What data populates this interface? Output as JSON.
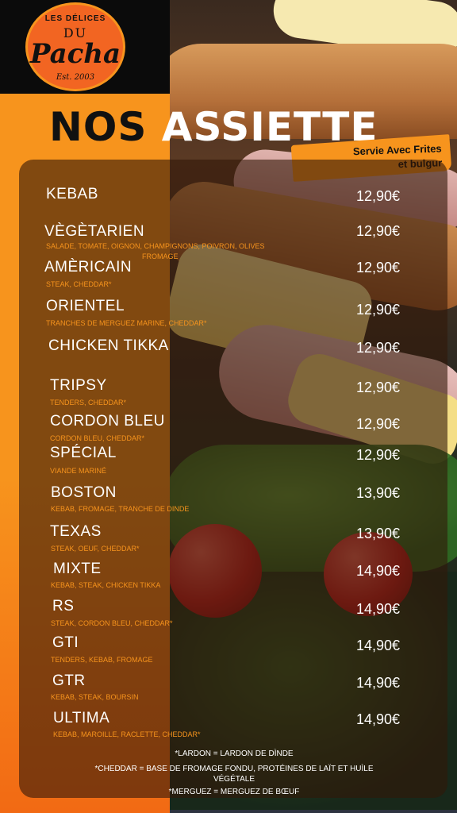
{
  "logo": {
    "top": "LES DÉLICES",
    "du": "DU",
    "main": "Pacha",
    "est": "Est. 2003"
  },
  "title": {
    "part1": "NOS",
    "part2": "ASSIETTE"
  },
  "badge": {
    "line1": "Servie Avec Frites",
    "line2": "et bulgur"
  },
  "colors": {
    "orange": "#f7941d",
    "dark_orange": "#f26522",
    "black": "#0b0b0b"
  },
  "menu": [
    {
      "name": "KEBAB",
      "price": "12,90€",
      "desc": ""
    },
    {
      "name": "VÈGÈTARIEN",
      "price": "12,90€",
      "desc": "SALADE, TOMATE, OIGNON, CHAMPIGNONS, POIVRON, OLIVES",
      "desc2": "FROMAGE"
    },
    {
      "name": "AMÈRICAIN",
      "price": "12,90€",
      "desc": "STEAK, CHEDDAR*"
    },
    {
      "name": "ORIENTEL",
      "price": "12,90€",
      "desc": "TRANCHES DE MERGUEZ MARINE, CHEDDAR*"
    },
    {
      "name": "CHICKEN TIKKA",
      "price": "12,90€",
      "desc": ""
    },
    {
      "name": "TRIPSY",
      "price": "12,90€",
      "desc": "TENDERS, CHEDDAR*"
    },
    {
      "name": "CORDON BLEU",
      "price": "12,90€",
      "desc": "CORDON BLEU, CHEDDAR*"
    },
    {
      "name": "SPÉCIAL",
      "price": "12,90€",
      "desc": "VIANDE MARINÉ"
    },
    {
      "name": "BOSTON",
      "price": "13,90€",
      "desc": "KEBAB, FROMAGE, TRANCHE DE DINDE"
    },
    {
      "name": "TEXAS",
      "price": "13,90€",
      "desc": "STEAK, OEUF, CHEDDAR*"
    },
    {
      "name": "MIXTE",
      "price": "14,90€",
      "desc": "KEBAB, STEAK, CHICKEN TIKKA"
    },
    {
      "name": "RS",
      "price": "14,90€",
      "desc": "STEAK, CORDON BLEU, CHEDDAR*"
    },
    {
      "name": "GTI",
      "price": "14,90€",
      "desc": "TENDERS, KEBAB, FROMAGE"
    },
    {
      "name": "GTR",
      "price": "14,90€",
      "desc": "KEBAB, STEAK, BOURSIN"
    },
    {
      "name": "ULTIMA",
      "price": "14,90€",
      "desc": "KEBAB, MAROILLE, RACLETTE, CHEDDAR*"
    }
  ],
  "footnotes": {
    "lardon": "*LARDON = LARDON DE DÌNDE",
    "cheddar1": "*CHEDDAR = BASE DE FROMAGE FONDU, PROTÉINES DE LAÏT ET HUÌLE",
    "cheddar2": "VÉGÉTALE",
    "merguez": "*MERGUEZ = MERGUEZ DE BŒUF"
  }
}
